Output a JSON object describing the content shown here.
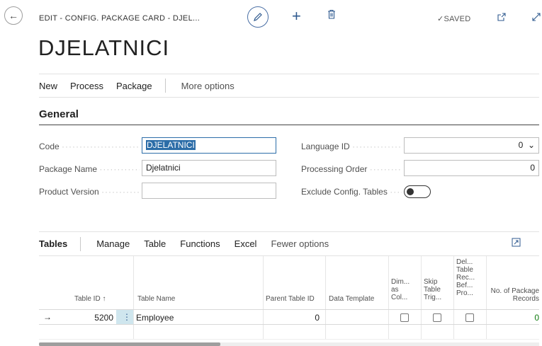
{
  "header": {
    "breadcrumb": "EDIT - CONFIG. PACKAGE CARD - DJEL...",
    "saved_label": "SAVED",
    "saved_check": "✓"
  },
  "page": {
    "title": "DJELATNICI"
  },
  "actions": {
    "items": [
      "New",
      "Process",
      "Package"
    ],
    "more": "More options"
  },
  "general": {
    "title": "General",
    "code_label": "Code",
    "code_value": "DJELATNICI",
    "package_name_label": "Package Name",
    "package_name_value": "Djelatnici",
    "product_version_label": "Product Version",
    "product_version_value": "",
    "language_id_label": "Language ID",
    "language_id_value": "0",
    "processing_order_label": "Processing Order",
    "processing_order_value": "0",
    "exclude_label": "Exclude Config. Tables",
    "exclude_value": false
  },
  "tables_part": {
    "title": "Tables",
    "actions": [
      "Manage",
      "Table",
      "Functions",
      "Excel"
    ],
    "fewer": "Fewer options",
    "columns": {
      "table_id": "Table ID ↑",
      "table_name": "Table Name",
      "parent_table_id": "Parent Table ID",
      "data_template": "Data Template",
      "dim_as_col": "Dim... as Col...",
      "skip_table_trig": "Skip Table Trig...",
      "del_table_rec": "Del... Table Rec... Bef... Pro...",
      "no_package_records": "No. of Package Records"
    },
    "rows": [
      {
        "row_marker": "→",
        "table_id": "5200",
        "row_menu": "⋮",
        "table_name": "Employee",
        "parent_table_id": "0",
        "data_template": "",
        "dim_as_col": false,
        "skip_table_trig": false,
        "del_table_rec": false,
        "no_package_records": "0"
      }
    ]
  },
  "colors": {
    "accent": "#2c6da8",
    "icon": "#2f5a8f",
    "link": "#0f7b0f"
  }
}
